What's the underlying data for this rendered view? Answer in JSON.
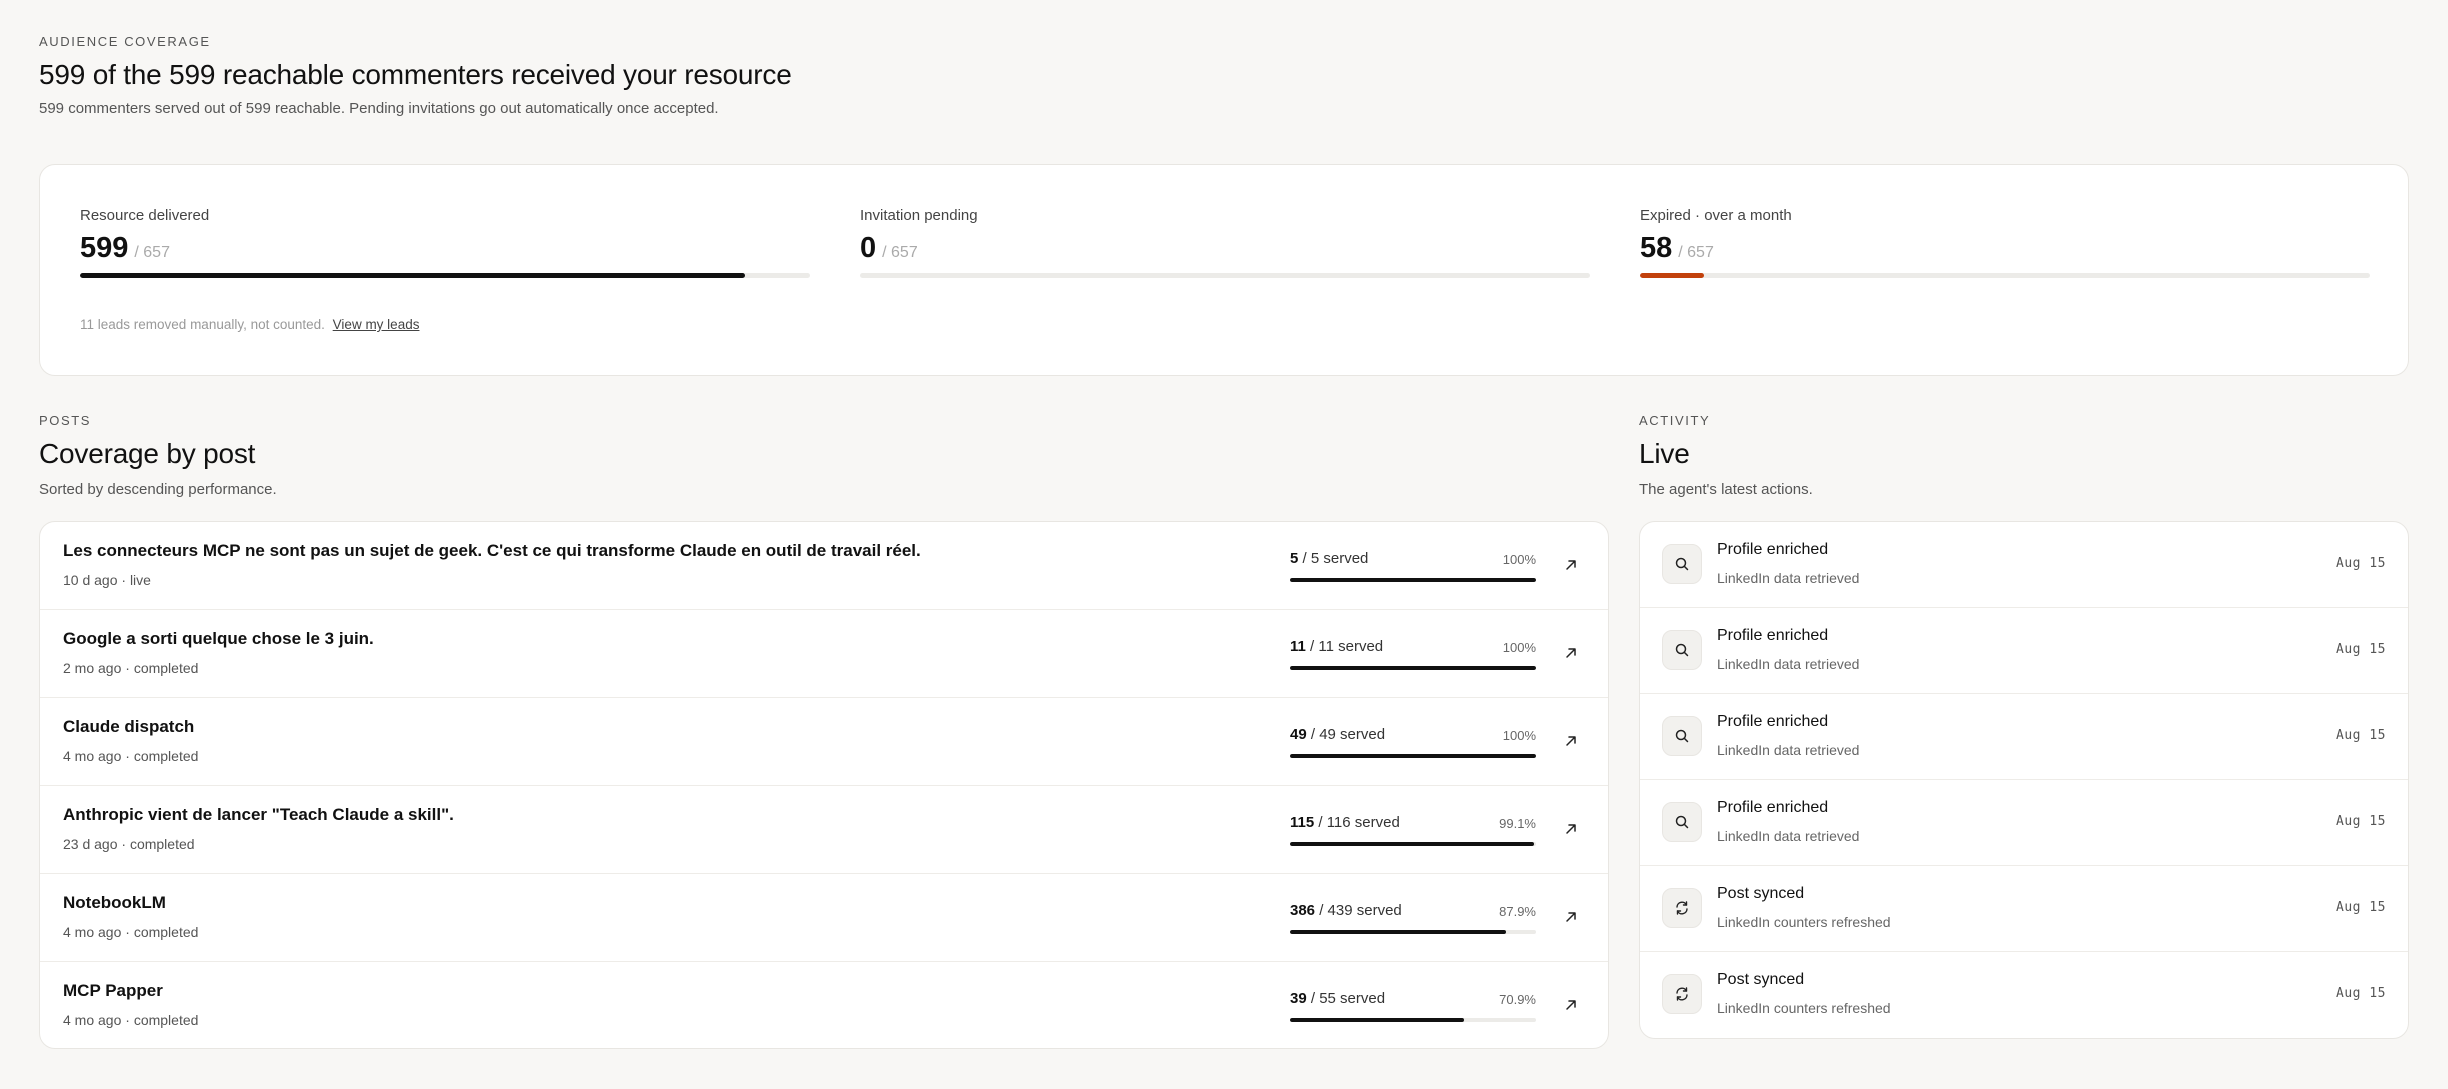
{
  "header": {
    "eyebrow": "AUDIENCE COVERAGE",
    "title": "599 of the 599 reachable commenters received your resource",
    "subtitle": "599 commenters served out of 599 reachable. Pending invitations go out automatically once accepted."
  },
  "metrics": [
    {
      "label": "Resource delivered",
      "value": "599",
      "total": "/ 657",
      "fraction": 0.911,
      "color": "#111111"
    },
    {
      "label": "Invitation pending",
      "value": "0",
      "total": "/ 657",
      "fraction": 0.0,
      "color": "#111111"
    },
    {
      "label": "Expired · over a month",
      "value": "58",
      "total": "/ 657",
      "fraction": 0.088,
      "color": "#c2410c"
    }
  ],
  "note": {
    "text": "11 leads removed manually, not counted.",
    "link": "View my leads"
  },
  "posts_section": {
    "eyebrow": "POSTS",
    "title": "Coverage by post",
    "subtitle": "Sorted by descending performance.",
    "rows": [
      {
        "title": "Les connecteurs MCP ne sont pas un sujet de geek. C'est ce qui transforme Claude en outil de travail réel.",
        "meta": "10 d ago · live",
        "served": "5",
        "of": " / 5 served",
        "pct": "100%",
        "fraction": 1.0
      },
      {
        "title": "Google a sorti quelque chose le 3 juin.",
        "meta": "2 mo ago · completed",
        "served": "11",
        "of": " / 11 served",
        "pct": "100%",
        "fraction": 1.0
      },
      {
        "title": "Claude dispatch",
        "meta": "4 mo ago · completed",
        "served": "49",
        "of": " / 49 served",
        "pct": "100%",
        "fraction": 1.0
      },
      {
        "title": "Anthropic vient de lancer \"Teach Claude a skill\".",
        "meta": "23 d ago · completed",
        "served": "115",
        "of": " / 116 served",
        "pct": "99.1%",
        "fraction": 0.991
      },
      {
        "title": "NotebookLM",
        "meta": "4 mo ago · completed",
        "served": "386",
        "of": " / 439 served",
        "pct": "87.9%",
        "fraction": 0.879
      },
      {
        "title": "MCP Papper",
        "meta": "4 mo ago · completed",
        "served": "39",
        "of": " / 55 served",
        "pct": "70.9%",
        "fraction": 0.709
      }
    ]
  },
  "activity_section": {
    "eyebrow": "ACTIVITY",
    "title": "Live",
    "subtitle": "The agent's latest actions.",
    "rows": [
      {
        "icon": "search-icon",
        "title": "Profile enriched",
        "sub": "LinkedIn data retrieved",
        "date": "Aug 15"
      },
      {
        "icon": "search-icon",
        "title": "Profile enriched",
        "sub": "LinkedIn data retrieved",
        "date": "Aug 15"
      },
      {
        "icon": "search-icon",
        "title": "Profile enriched",
        "sub": "LinkedIn data retrieved",
        "date": "Aug 15"
      },
      {
        "icon": "search-icon",
        "title": "Profile enriched",
        "sub": "LinkedIn data retrieved",
        "date": "Aug 15"
      },
      {
        "icon": "refresh-icon",
        "title": "Post synced",
        "sub": "LinkedIn counters refreshed",
        "date": "Aug 15"
      },
      {
        "icon": "refresh-icon",
        "title": "Post synced",
        "sub": "LinkedIn counters refreshed",
        "date": "Aug 15"
      }
    ]
  }
}
